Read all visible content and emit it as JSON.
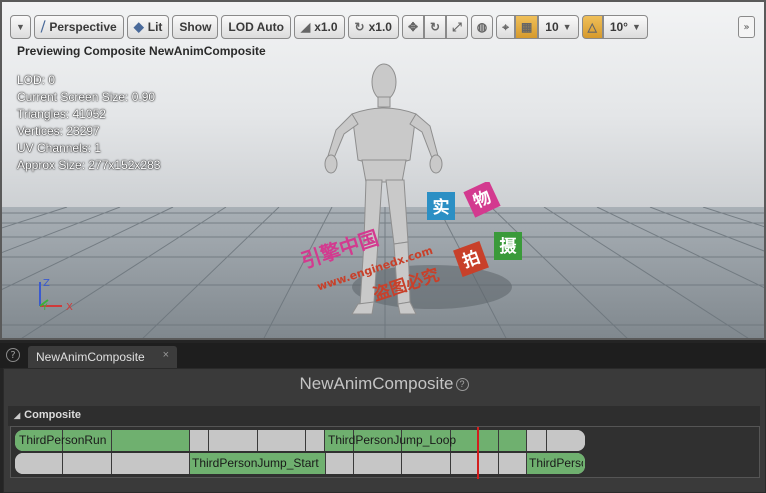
{
  "toolbar": {
    "perspective": "Perspective",
    "lit": "Lit",
    "show": "Show",
    "lod": "LOD Auto",
    "speed1": "x1.0",
    "speed2": "x1.0",
    "grid_snap": "10",
    "angle_snap": "10°"
  },
  "viewport": {
    "preview_title": "Previewing Composite NewAnimComposite",
    "stats": {
      "lod": "LOD: 0",
      "screen_size": "Current Screen Size: 0.90",
      "triangles": "Triangles: 41052",
      "vertices": "Vertices: 23297",
      "uv_channels": "UV Channels: 1",
      "approx_size": "Approx Size: 277x152x283"
    },
    "axis": {
      "x": "X",
      "y": "Y",
      "z": "Z"
    },
    "watermark": {
      "a": "实",
      "b": "物",
      "c": "拍",
      "d": "摄",
      "line1": "引擎中国",
      "line2": "www.enginedx.com",
      "line3": "盗图必究"
    }
  },
  "tab": {
    "label": "NewAnimComposite",
    "close": "×"
  },
  "panel": {
    "title": "NewAnimComposite",
    "section": "Composite",
    "track1_label_a": "ThirdPersonRun",
    "track1_label_b": "ThirdPersonJump_Loop",
    "track2_label_a": "ThirdPersonJump_Start",
    "track2_label_b": "ThirdPersonJump_End"
  },
  "colors": {
    "segment": "#6fb06f",
    "scrub": "#d21e1e",
    "accent": "#d69a2c"
  }
}
